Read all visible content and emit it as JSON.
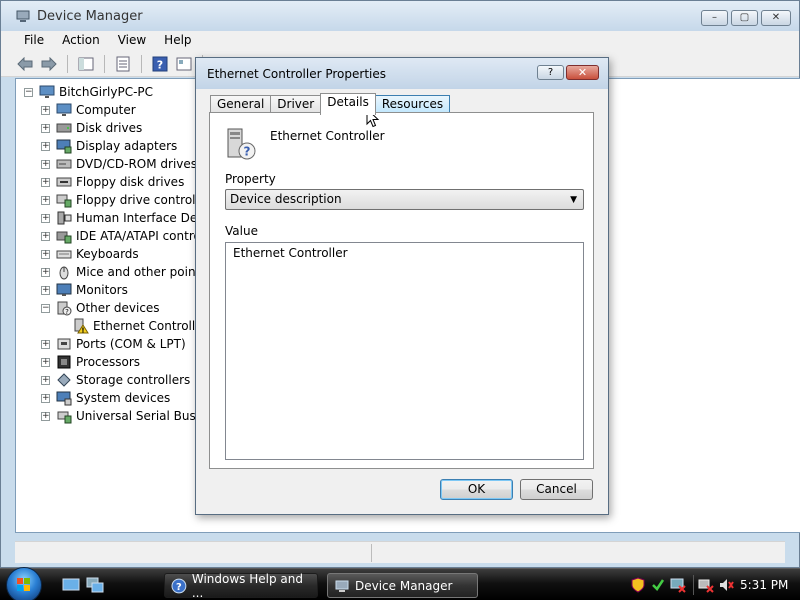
{
  "window": {
    "title": "Device Manager",
    "controls": {
      "minimize": "–",
      "maximize": "▢",
      "close": "✕"
    }
  },
  "menu": [
    "File",
    "Action",
    "View",
    "Help"
  ],
  "tree": {
    "root": "BitchGirlyPC-PC",
    "items": [
      {
        "label": "Computer",
        "icon": "computer-icon"
      },
      {
        "label": "Disk drives",
        "icon": "disk-icon"
      },
      {
        "label": "Display adapters",
        "icon": "display-icon"
      },
      {
        "label": "DVD/CD-ROM drives",
        "icon": "dvd-icon"
      },
      {
        "label": "Floppy disk drives",
        "icon": "floppy-icon"
      },
      {
        "label": "Floppy drive controller",
        "icon": "controller-icon"
      },
      {
        "label": "Human Interface Devic",
        "icon": "hid-icon"
      },
      {
        "label": "IDE ATA/ATAPI contro",
        "icon": "ide-icon"
      },
      {
        "label": "Keyboards",
        "icon": "keyboard-icon"
      },
      {
        "label": "Mice and other pointin",
        "icon": "mouse-icon"
      },
      {
        "label": "Monitors",
        "icon": "monitor-icon"
      },
      {
        "label": "Other devices",
        "icon": "unknown-device-icon",
        "expanded": true
      },
      {
        "label": "Ethernet Controller",
        "icon": "warning-device-icon",
        "child": true
      },
      {
        "label": "Ports (COM & LPT)",
        "icon": "port-icon"
      },
      {
        "label": "Processors",
        "icon": "processor-icon"
      },
      {
        "label": "Storage controllers",
        "icon": "storage-icon"
      },
      {
        "label": "System devices",
        "icon": "system-icon"
      },
      {
        "label": "Universal Serial Bus co",
        "icon": "usb-icon"
      }
    ]
  },
  "dialog": {
    "title": "Ethernet Controller Properties",
    "help_button": "?",
    "close_button": "✕",
    "tabs": [
      "General",
      "Driver",
      "Details",
      "Resources"
    ],
    "active_tab": "Details",
    "device_name": "Ethernet Controller",
    "property_label": "Property",
    "property_selected": "Device description",
    "value_label": "Value",
    "value_text": "Ethernet Controller",
    "ok": "OK",
    "cancel": "Cancel"
  },
  "taskbar": {
    "buttons": [
      {
        "label": "Windows Help and ...",
        "icon": "help-icon"
      },
      {
        "label": "Device Manager",
        "icon": "device-manager-icon"
      }
    ],
    "clock": "5:31 PM"
  }
}
